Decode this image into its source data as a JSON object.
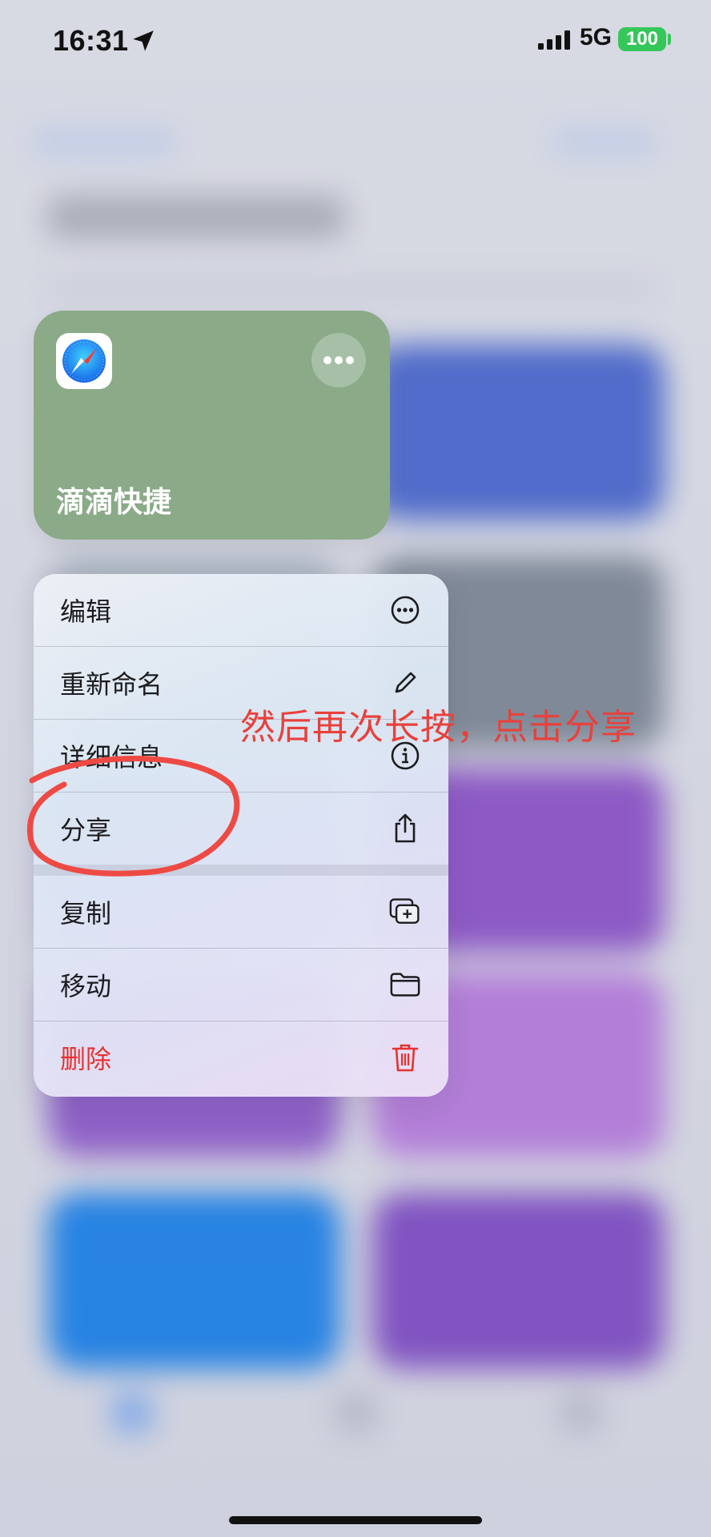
{
  "status_bar": {
    "time": "16:31",
    "network": "5G",
    "battery": "100"
  },
  "shortcut": {
    "title": "滴滴快捷",
    "app_icon": "safari-icon",
    "color": "#8aaa88"
  },
  "menu": {
    "items": [
      {
        "label": "编辑",
        "icon": "ellipsis-circle-icon"
      },
      {
        "label": "重新命名",
        "icon": "pencil-icon"
      },
      {
        "label": "详细信息",
        "icon": "info-circle-icon"
      },
      {
        "label": "分享",
        "icon": "share-icon"
      },
      {
        "label": "复制",
        "icon": "duplicate-icon"
      },
      {
        "label": "移动",
        "icon": "folder-icon"
      },
      {
        "label": "删除",
        "icon": "trash-icon"
      }
    ],
    "danger_color": "#e5322f"
  },
  "annotation": {
    "text": "然后再次长按，点击分享",
    "color": "#e8413b"
  }
}
